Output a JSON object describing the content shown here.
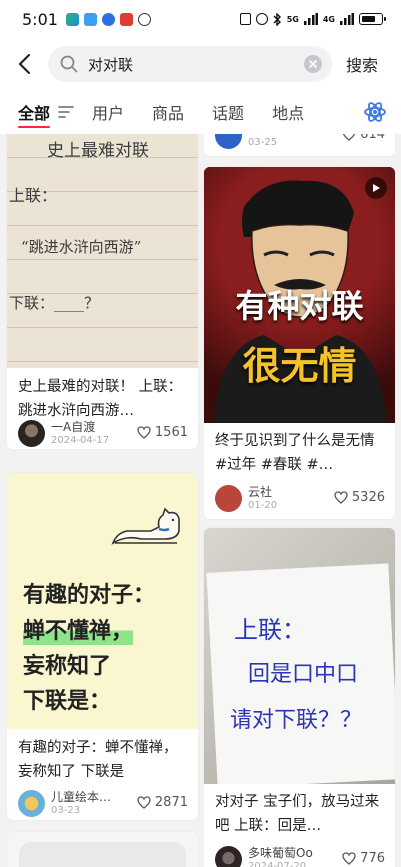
{
  "status_bar": {
    "time": "5:01",
    "network_labels": [
      "5G",
      "4G"
    ]
  },
  "search": {
    "query": "对对联",
    "submit_label": "搜索"
  },
  "tabs": [
    {
      "label": "全部",
      "active": true
    },
    {
      "label": "用户",
      "active": false
    },
    {
      "label": "商品",
      "active": false
    },
    {
      "label": "话题",
      "active": false
    },
    {
      "label": "地点",
      "active": false
    }
  ],
  "colors": {
    "accent": "#ff2442",
    "ai_icon": "#3d7be0"
  },
  "cards_left": [
    {
      "cover_text": {
        "heading": "史上最难对联",
        "line1": "上联：",
        "line2": "“跳进水浒向西游”",
        "line3": "下联：____？"
      },
      "title": "史上最难的对联！ 上联：跳进水浒向西游…",
      "author": "一A自渡",
      "date": "2024-04-17",
      "likes": "1561"
    },
    {
      "cover_text": {
        "line1": "有趣的对子：",
        "line2": "蝉不懂禅，",
        "line3": "妄称知了",
        "line4": "下联是："
      },
      "title": "有趣的对子：蝉不懂禅，妄称知了 下联是",
      "author": "儿童绘本…",
      "date": "03-23",
      "likes": "2871"
    }
  ],
  "cards_right": [
    {
      "date": "03-25",
      "likes": "614"
    },
    {
      "cover_text": {
        "line1": "有种对联",
        "line2": "很无情"
      },
      "title": "终于见识到了什么是无情 #过年 #春联 #…",
      "author": "云社",
      "date": "01-20",
      "likes": "5326"
    },
    {
      "cover_text": {
        "line1": "上联：",
        "line2": "回是口中口",
        "line3": "请对下联？？"
      },
      "title": "对对子 宝子们，放马过来吧 上联：回是…",
      "author": "多味葡萄Oo",
      "date": "2024-07-20",
      "likes": "776"
    }
  ]
}
